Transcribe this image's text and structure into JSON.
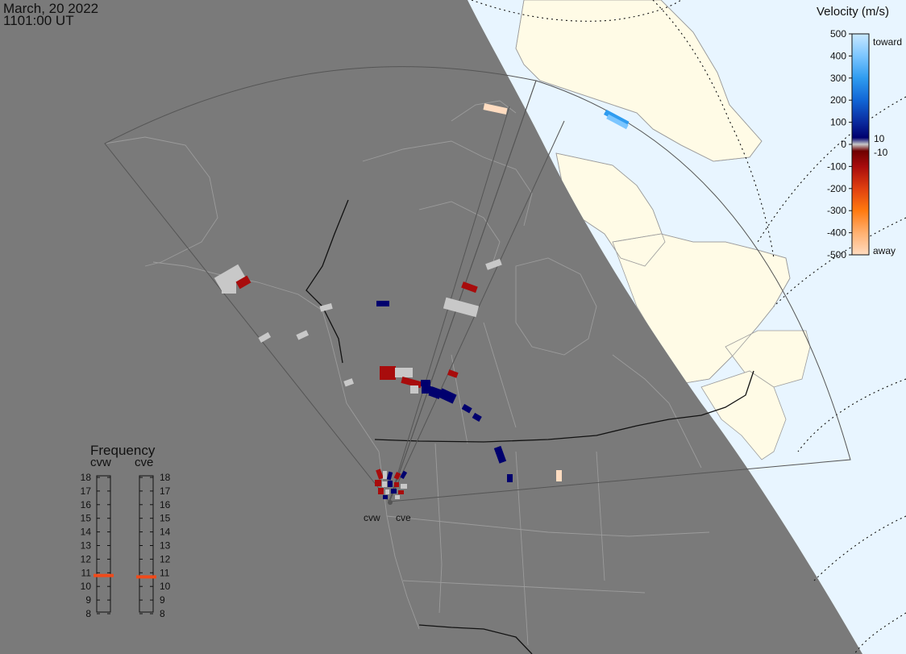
{
  "header": {
    "date": "March, 20 2022",
    "time": "1101:00 UT"
  },
  "radars": [
    {
      "code": "cvw",
      "label": "cvw"
    },
    {
      "code": "cve",
      "label": "cve"
    }
  ],
  "frequency_legend": {
    "title": "Frequency",
    "columns": [
      {
        "label": "cvw",
        "selected_mhz": 10.8
      },
      {
        "label": "cve",
        "selected_mhz": 10.7
      }
    ],
    "ticks": [
      "18",
      "17",
      "16",
      "15",
      "14",
      "13",
      "12",
      "11",
      "10",
      "9",
      "8"
    ],
    "marker_color": "#f04a1a"
  },
  "velocity_legend": {
    "title": "Velocity (m/s)",
    "ticks": [
      "500",
      "400",
      "300",
      "200",
      "100",
      "0",
      "-100",
      "-200",
      "-300",
      "-400",
      "-500"
    ],
    "side_labels": {
      "top": "toward",
      "near_zero_pos": "10",
      "near_zero_neg": "-10",
      "bottom": "away"
    },
    "colors": {
      "toward_500": "#c8e8ff",
      "toward_400": "#7cc6ff",
      "toward_300": "#2f9cf0",
      "toward_200": "#1166d6",
      "toward_100": "#0a2a9e",
      "toward_low": "#00006e",
      "ground_scatter": "#c8c8c8",
      "away_low": "#6e0000",
      "away_100": "#a80c0c",
      "away_200": "#e04010",
      "away_300": "#ff7a10",
      "away_400": "#ffb070",
      "away_500": "#ffdcc0"
    }
  },
  "map_colors": {
    "night": "#7a7a7a",
    "ocean_day": "#e8f5ff",
    "land_day": "#fffbe6",
    "boundary": "#9c9c9c",
    "dark_boundary": "#111111",
    "fov": "#555555"
  }
}
